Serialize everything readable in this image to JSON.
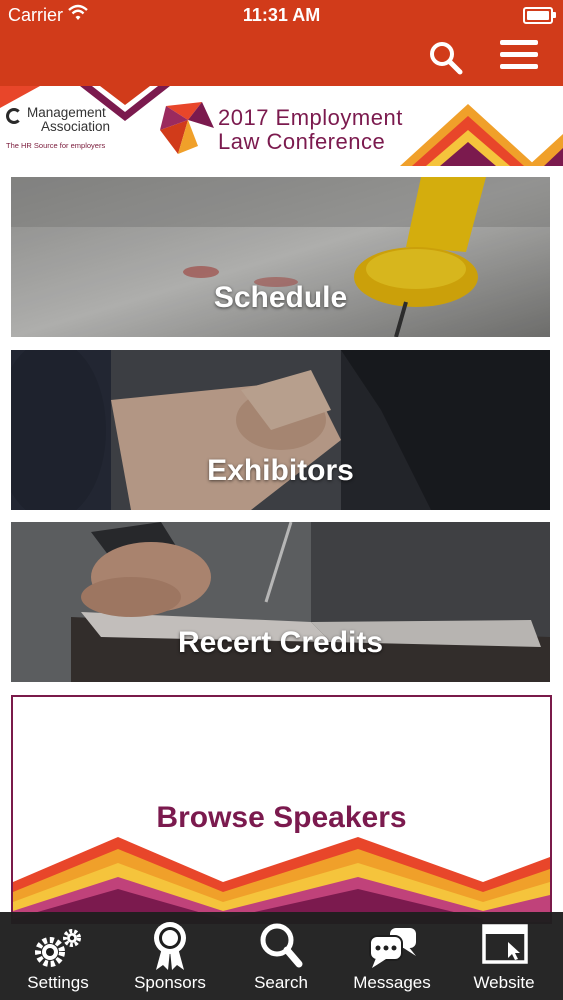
{
  "status_bar": {
    "carrier": "Carrier",
    "time": "11:31 AM"
  },
  "nav_bar": {
    "search_icon": "search-icon",
    "menu_icon": "hamburger-menu-icon"
  },
  "banner": {
    "org_name_line1": "Management",
    "org_name_line2": "Association",
    "org_tagline": "The HR Source for employers",
    "conference_line1": "2017 Employment",
    "conference_line2": "Law Conference"
  },
  "tiles": [
    {
      "label": "Schedule"
    },
    {
      "label": "Exhibitors"
    },
    {
      "label": "Recert Credits"
    },
    {
      "label": "Browse Speakers"
    }
  ],
  "tab_bar": [
    {
      "label": "Settings",
      "icon": "gears-icon"
    },
    {
      "label": "Sponsors",
      "icon": "ribbon-award-icon"
    },
    {
      "label": "Search",
      "icon": "search-icon"
    },
    {
      "label": "Messages",
      "icon": "chat-bubbles-icon"
    },
    {
      "label": "Website",
      "icon": "browser-window-icon"
    }
  ],
  "colors": {
    "brand_red": "#d13b1a",
    "brand_purple": "#7b1a4e",
    "tab_bar_bg": "#1e1e1e"
  }
}
